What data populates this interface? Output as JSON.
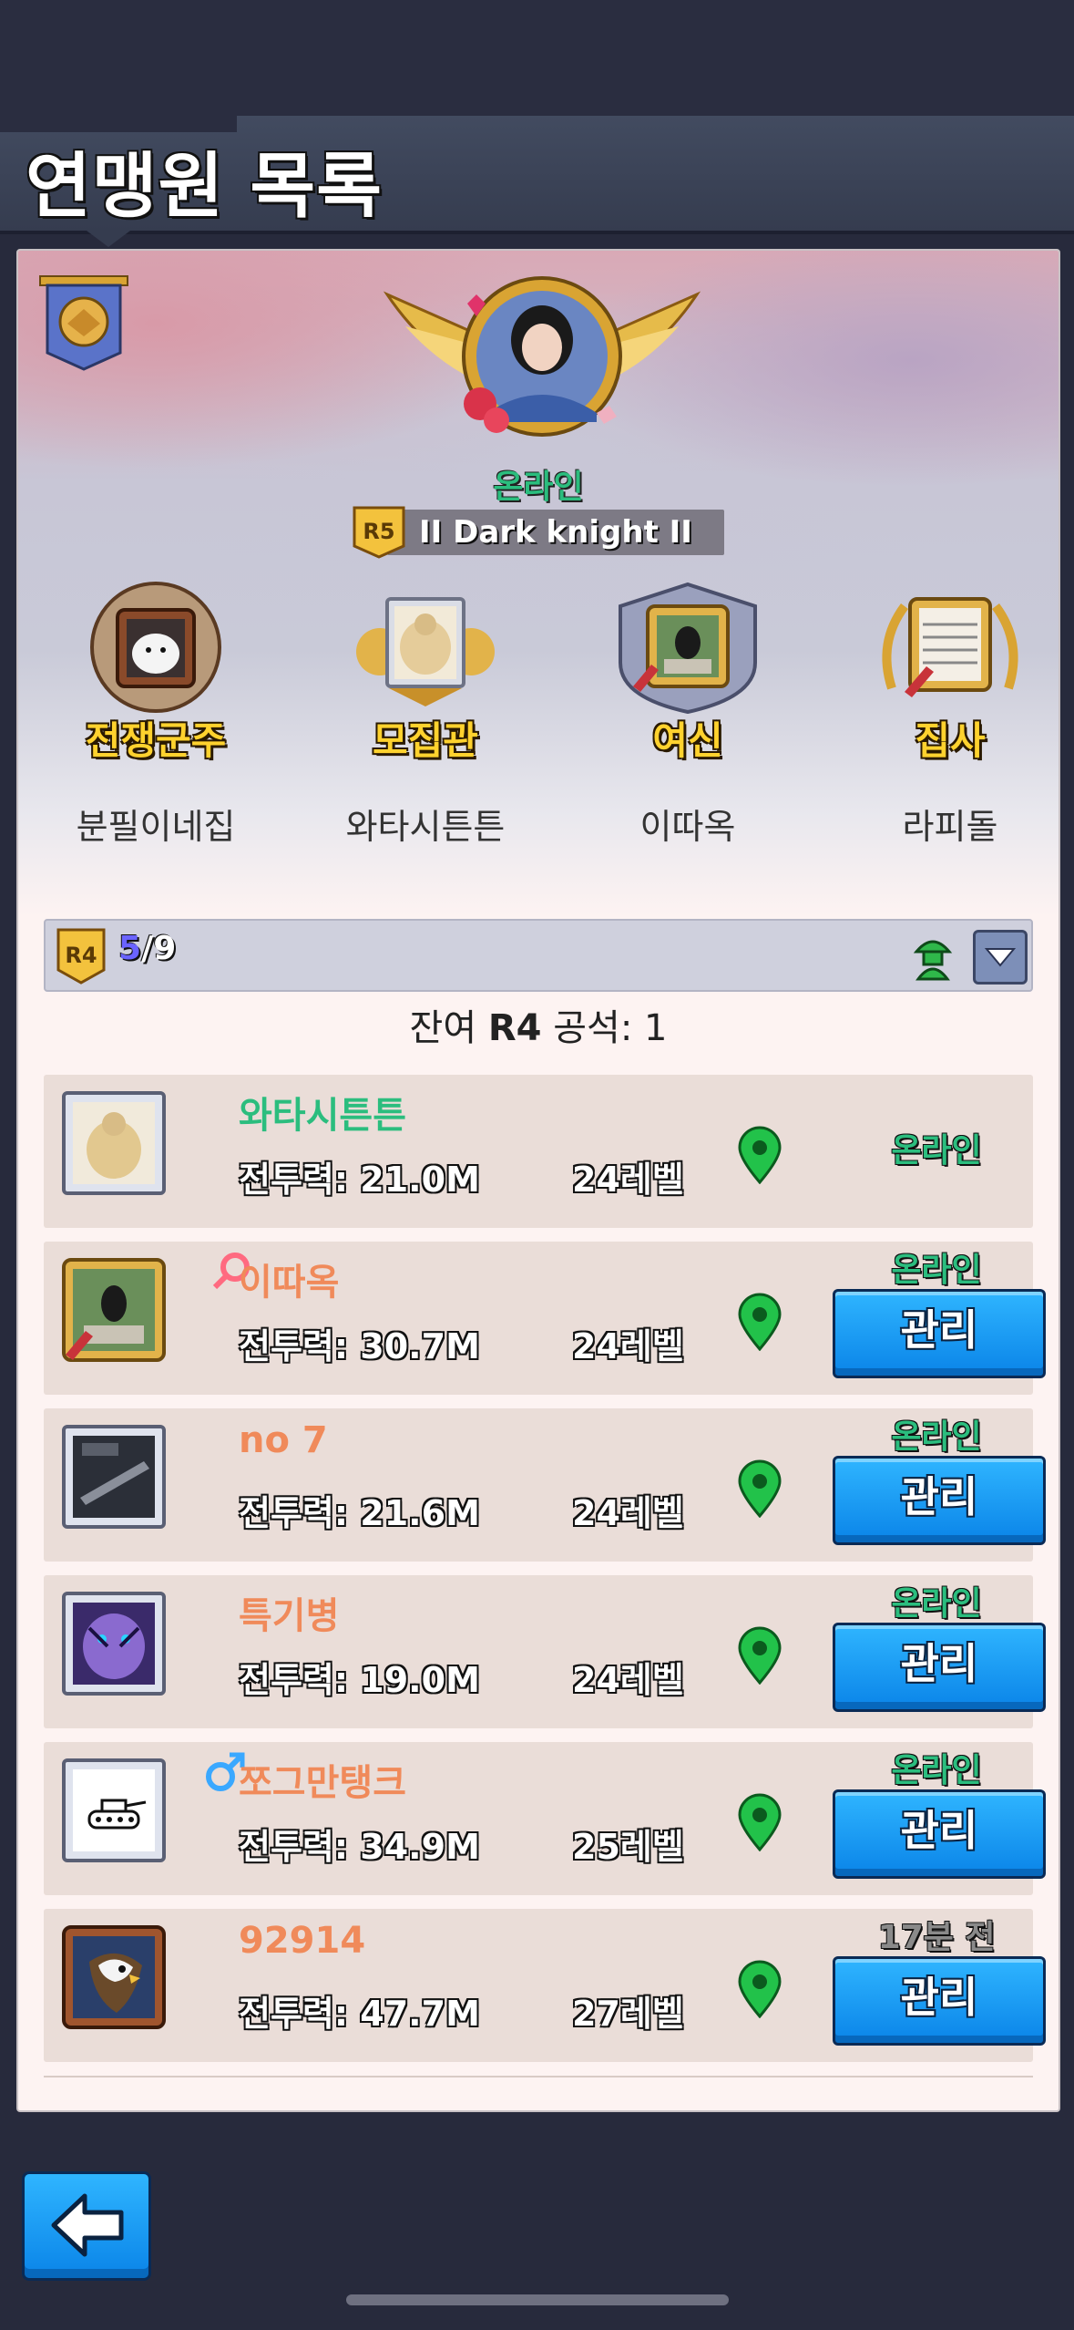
{
  "header": {
    "title": "연맹원 목록"
  },
  "leader": {
    "status": "온라인",
    "rank": "R5",
    "name": "II Dark knight II"
  },
  "officers": [
    {
      "role": "전쟁군주",
      "name": "분필이네집"
    },
    {
      "role": "모집관",
      "name": "와타시튼튼"
    },
    {
      "role": "여신",
      "name": "이따옥"
    },
    {
      "role": "집사",
      "name": "라피돌"
    }
  ],
  "filter": {
    "rank": "R4",
    "count_current": "5",
    "count_total": "/9"
  },
  "remaining": {
    "prefix": "잔여 ",
    "rank": "R4",
    "suffix": " 공석: 1"
  },
  "members": [
    {
      "name": "와타시튼튼",
      "name_color": "#2bbd7e",
      "power": "전투력: 21.0M",
      "level": "24레벨",
      "status": "온라인",
      "status_color": "#2bbd7e",
      "manage": ""
    },
    {
      "name": "이따옥",
      "name_color": "#f08a5a",
      "power": "전투력: 30.7M",
      "level": "24레벨",
      "status": "온라인",
      "status_color": "#2bbd7e",
      "manage": "관리",
      "tag_icon": "female-tag-icon"
    },
    {
      "name": "no 7",
      "name_color": "#f08a5a",
      "power": "전투력: 21.6M",
      "level": "24레벨",
      "status": "온라인",
      "status_color": "#2bbd7e",
      "manage": "관리"
    },
    {
      "name": "특기병",
      "name_color": "#f08a5a",
      "power": "전투력: 19.0M",
      "level": "24레벨",
      "status": "온라인",
      "status_color": "#2bbd7e",
      "manage": "관리"
    },
    {
      "name": "쪼그만탱크",
      "name_color": "#f08a5a",
      "power": "전투력: 34.9M",
      "level": "25레벨",
      "status": "온라인",
      "status_color": "#2bbd7e",
      "manage": "관리",
      "tag_icon": "male-tag-icon"
    },
    {
      "name": "92914",
      "name_color": "#f08a5a",
      "power": "전투력: 47.7M",
      "level": "27레벨",
      "status": "17분 전",
      "status_color": "#8a8a8a",
      "manage": "관리"
    }
  ]
}
